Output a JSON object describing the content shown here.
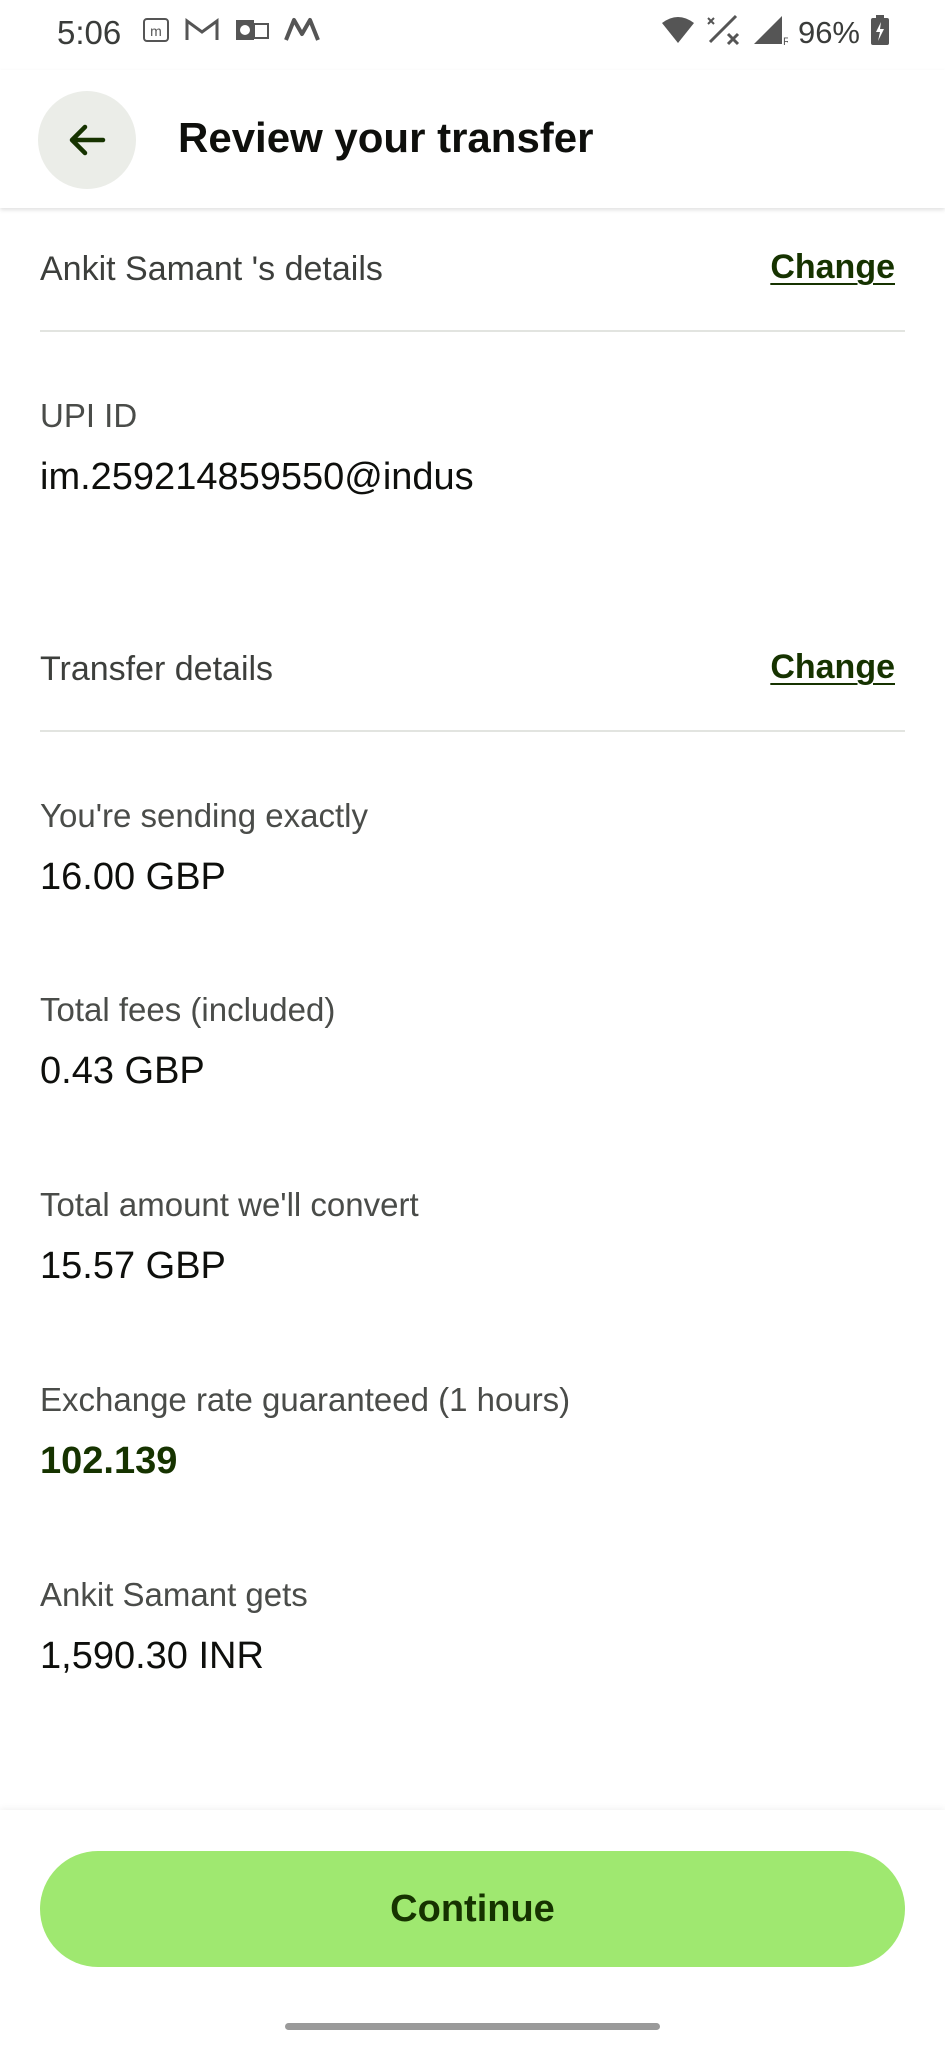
{
  "status_bar": {
    "time": "5:06",
    "battery_percent": "96%",
    "left_icons": [
      "m-app-icon",
      "gmail-icon",
      "outlook-icon",
      "myntra-icon"
    ],
    "right_icons": [
      "wifi-icon",
      "signal-x-icon",
      "signal-r-icon",
      "battery-charging-icon"
    ]
  },
  "header": {
    "title": "Review your transfer",
    "back_icon": "arrow-left-icon"
  },
  "recipient_section": {
    "label": "Ankit Samant 's details",
    "change_label": "Change",
    "fields": [
      {
        "label": "UPI ID",
        "value": "im.259214859550@indus"
      }
    ]
  },
  "transfer_section": {
    "label": "Transfer details",
    "change_label": "Change",
    "fields": [
      {
        "label": "You're sending exactly",
        "value": "16.00 GBP"
      },
      {
        "label": "Total fees (included)",
        "value": "0.43 GBP"
      },
      {
        "label": "Total amount we'll convert",
        "value": "15.57 GBP"
      },
      {
        "label": "Exchange rate guaranteed (1 hours)",
        "value": "102.139"
      },
      {
        "label": "Ankit Samant  gets",
        "value": "1,590.30 INR"
      }
    ]
  },
  "footer": {
    "continue_label": "Continue"
  },
  "colors": {
    "accent_green": "#9fe870",
    "forest_green": "#163300",
    "back_button_bg": "#ebede8"
  }
}
